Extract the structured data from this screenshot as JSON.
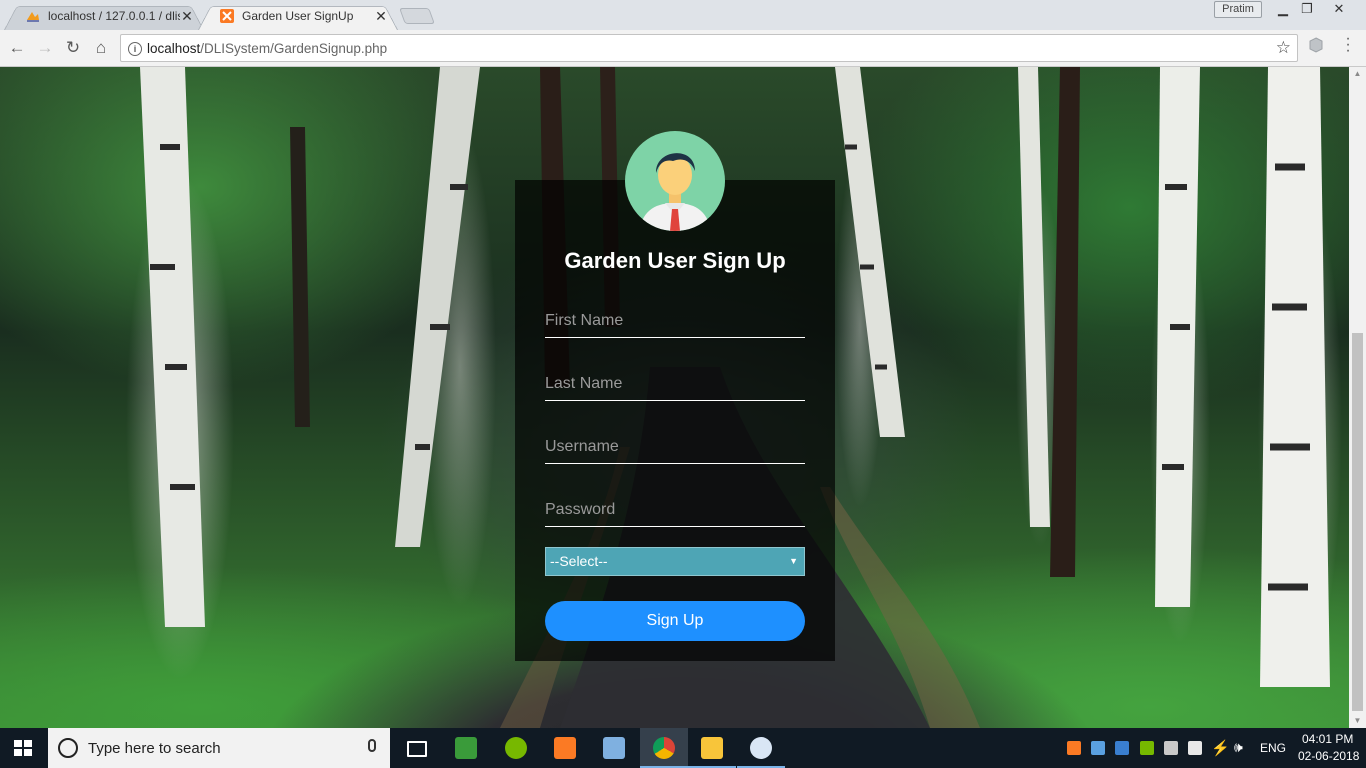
{
  "browser": {
    "tabs": [
      {
        "title": "localhost / 127.0.0.1 / dlis",
        "active": false
      },
      {
        "title": "Garden User SignUp",
        "active": true
      }
    ],
    "profile_name": "Pratim",
    "address": {
      "host": "localhost",
      "path": "/DLISystem/GardenSignup.php"
    }
  },
  "form": {
    "title": "Garden User Sign Up",
    "first_name_placeholder": "First Name",
    "last_name_placeholder": "Last Name",
    "username_placeholder": "Username",
    "password_placeholder": "Password",
    "select_value": "--Select--",
    "submit_label": "Sign Up"
  },
  "taskbar": {
    "search_placeholder": "Type here to search",
    "language": "ENG",
    "time": "04:01 PM",
    "date": "02-06-2018"
  },
  "colors": {
    "card_bg": "#000000ad",
    "signup_button": "#1e90ff",
    "select_bg": "#4ea5b5",
    "avatar_bg": "#7ed3a7",
    "taskbar_bg": "#101a24"
  }
}
